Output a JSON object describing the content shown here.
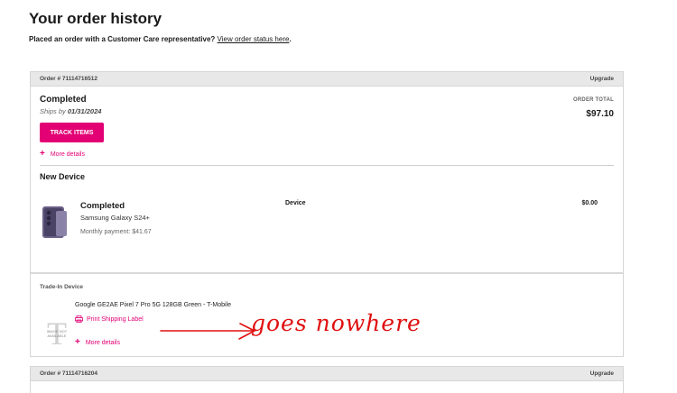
{
  "page": {
    "title": "Your order history",
    "intro_text": "Placed an order with a Customer Care representative?",
    "intro_link": "View order status here",
    "intro_period": "."
  },
  "orders": [
    {
      "number": "Order # 71114716512",
      "type": "Upgrade",
      "status": "Completed",
      "ships_by_label": "Ships by",
      "ships_by_date": "01/31/2024",
      "order_total_label": "ORDER TOTAL",
      "order_total": "$97.10",
      "track_button": "TRACK ITEMS",
      "more_details": "More details",
      "new_device": {
        "section_title": "New Device",
        "status": "Completed",
        "model": "Samsung Galaxy S24+",
        "monthly_payment": "Monthly payment: $41.67",
        "column_label": "Device",
        "price": "$0.00"
      },
      "trade_in": {
        "section_title": "Trade-In Device",
        "device_name": "Google GE2AE Pixel 7 Pro 5G 128GB Green - T-Mobile",
        "image_text": "IMAGE NOT AVAILABLE",
        "print_label": "Print Shipping Label",
        "more_details": "More details"
      }
    },
    {
      "number": "Order # 71114716204",
      "type": "Upgrade"
    }
  ],
  "annotation": {
    "text": "goes nowhere",
    "color": "#e01010"
  },
  "colors": {
    "brand": "#e20074",
    "header_bg": "#e8e8e8"
  },
  "icons": [
    "plus-icon",
    "printer-icon",
    "phone-image",
    "image-not-available"
  ]
}
